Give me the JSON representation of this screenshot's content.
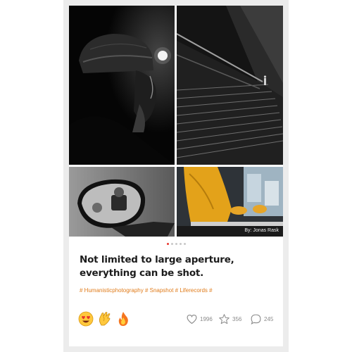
{
  "post": {
    "photo_credit": "By: Jonas Rask",
    "carousel": {
      "pages": 5,
      "active_index": 0
    },
    "title_lines": [
      "Not limited to large aperture,",
      "everything can be shot."
    ],
    "tags": "# Humanisticphotography # Snapshot # Liferecords #",
    "reactions": [
      "heart-eyes-emoji",
      "clapping-hands-emoji",
      "fire-emoji"
    ],
    "stats": {
      "likes": "1996",
      "favorites": "356",
      "comments": "245"
    }
  },
  "colors": {
    "accent_dot": "#e8382f",
    "tag": "#e07b1a",
    "stat": "#8a8a8a"
  }
}
